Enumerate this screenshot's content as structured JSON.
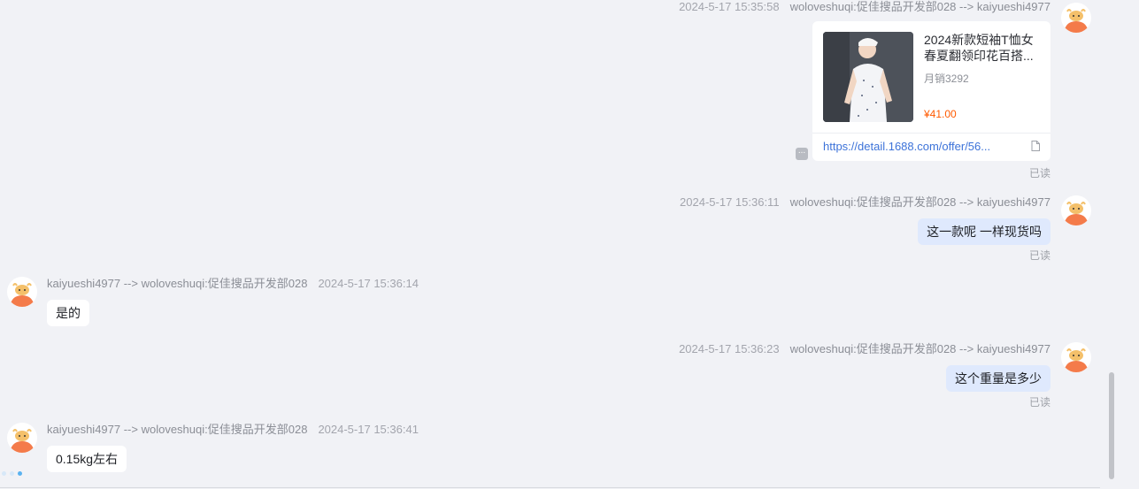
{
  "messages": [
    {
      "side": "right",
      "timestamp": "2024-5-17 15:35:58",
      "route": "woloveshuqi:促佳搜品开发部028 --> kaiyueshi4977",
      "type": "product-card",
      "product": {
        "title": "2024新款短袖T恤女春夏翻领印花百搭...",
        "sales": "月销3292",
        "price": "¥41.00",
        "link": "https://detail.1688.com/offer/56..."
      },
      "read": "已读"
    },
    {
      "side": "right",
      "timestamp": "2024-5-17 15:36:11",
      "route": "woloveshuqi:促佳搜品开发部028 --> kaiyueshi4977",
      "text": "这一款呢 一样现货吗",
      "read": "已读"
    },
    {
      "side": "left",
      "route": "kaiyueshi4977 --> woloveshuqi:促佳搜品开发部028",
      "timestamp": "2024-5-17 15:36:14",
      "text": "是的"
    },
    {
      "side": "right",
      "timestamp": "2024-5-17 15:36:23",
      "route": "woloveshuqi:促佳搜品开发部028 --> kaiyueshi4977",
      "text": "这个重量是多少",
      "read": "已读"
    },
    {
      "side": "left",
      "route": "kaiyueshi4977 --> woloveshuqi:促佳搜品开发部028",
      "timestamp": "2024-5-17 15:36:41",
      "text": "0.15kg左右"
    }
  ],
  "icons": {
    "avatar": "bull-avatar-icon",
    "more": "more-icon",
    "document": "document-icon"
  },
  "colors": {
    "background": "#f1f2f6",
    "outgoing_bubble": "#dfe9fd",
    "incoming_bubble": "#ffffff",
    "price": "#ff5a00",
    "link": "#3d73d9",
    "avatar_orange": "#f47b4a"
  }
}
